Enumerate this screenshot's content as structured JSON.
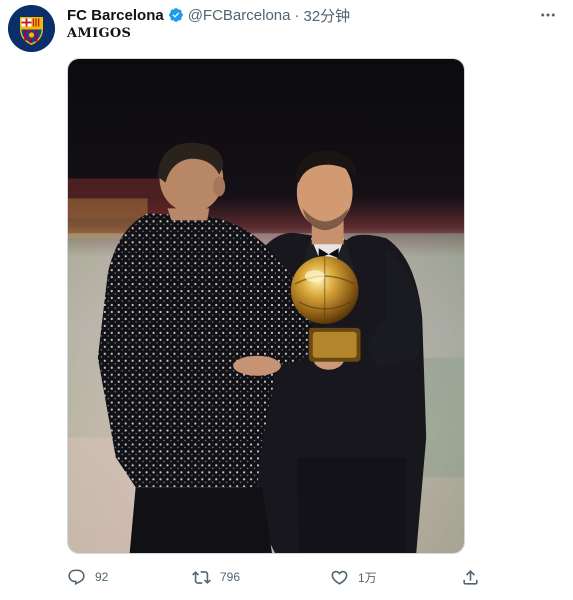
{
  "tweet": {
    "display_name": "FC Barcelona",
    "handle": "@FCBarcelona",
    "separator": "·",
    "time": "32分钟",
    "text": "AMIGOS",
    "avatar_icon": "fc-barcelona-crest",
    "verified_icon": "verified-badge-icon",
    "more_icon": "more-dots-icon",
    "media": {
      "description_icon": "photo",
      "alt": ""
    },
    "actions": {
      "reply_count": "92",
      "retweet_count": "796",
      "like_count": "1万",
      "reply_icon": "reply-icon",
      "retweet_icon": "retweet-icon",
      "like_icon": "heart-icon",
      "share_icon": "share-icon"
    }
  },
  "colors": {
    "verified_blue": "#1d9bf0",
    "secondary_text": "#536471",
    "primary_text": "#0f1419",
    "crest_blue": "#004d98",
    "crest_red": "#a50044",
    "crest_gold": "#edbb00"
  }
}
